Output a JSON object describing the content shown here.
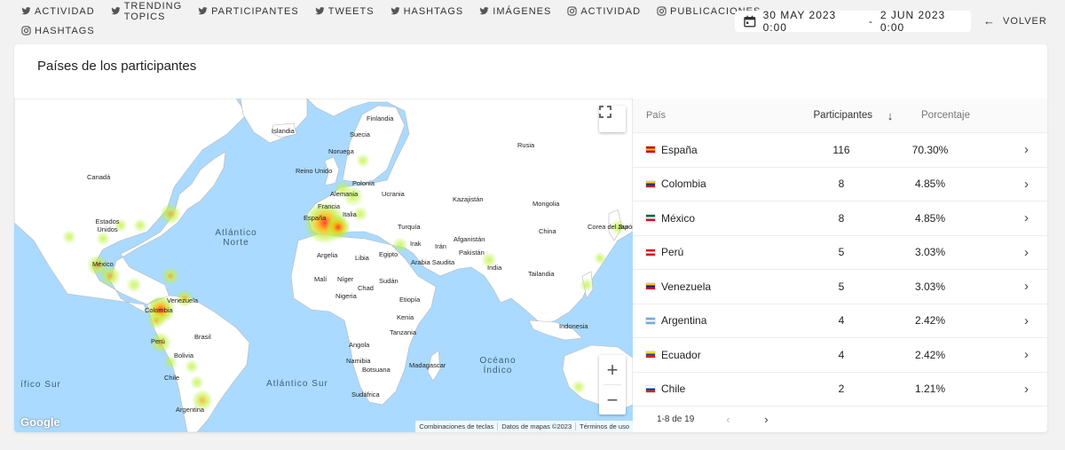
{
  "nav": {
    "row1": [
      {
        "label": "ACTIVIDAD",
        "icon": "twitter-icon"
      },
      {
        "label": "TRENDING TOPICS",
        "icon": "twitter-icon"
      },
      {
        "label": "PARTICIPANTES",
        "icon": "twitter-icon"
      },
      {
        "label": "TWEETS",
        "icon": "twitter-icon"
      },
      {
        "label": "HASHTAGS",
        "icon": "twitter-icon"
      },
      {
        "label": "IMÁGENES",
        "icon": "twitter-icon"
      },
      {
        "label": "ACTIVIDAD",
        "icon": "instagram-icon"
      },
      {
        "label": "PUBLICACIONES",
        "icon": "instagram-icon"
      }
    ],
    "row2": [
      {
        "label": "HASHTAGS",
        "icon": "instagram-icon"
      }
    ]
  },
  "daterange": {
    "start": "30 MAY 2023 0:00",
    "separator": "-",
    "end": "2 JUN 2023 0:00"
  },
  "back_label": "VOLVER",
  "card_title": "Países de los participantes",
  "map": {
    "labels": [
      "Islandia",
      "Finlandia",
      "Suecia",
      "Noruega",
      "Rusia",
      "Reino Unido",
      "Polonia",
      "Alemania",
      "Ucrania",
      "Canadá",
      "Francia",
      "Kazajistán",
      "Mongolia",
      "España",
      "Italia",
      "Estados Unidos",
      "Turquía",
      "Corea del Sur",
      "Japón",
      "China",
      "Irak",
      "Irán",
      "Afganistán",
      "Argelia",
      "Libia",
      "Egipto",
      "Arabia Saudita",
      "Pakistán",
      "India",
      "México",
      "Malí",
      "Níger",
      "Chad",
      "Sudán",
      "Tailandia",
      "Venezuela",
      "Colombia",
      "Nigeria",
      "Etiopía",
      "Kenia",
      "Perú",
      "Brasil",
      "Tanzania",
      "Indonesia",
      "Bolivia",
      "Angola",
      "Chile",
      "Namibia",
      "Botsuana",
      "Madagascar",
      "Sudáfrica",
      "Argentina"
    ],
    "oceans": [
      "Atlántico Norte",
      "Atlántico Sur",
      "Océano Índico",
      "ífico Sur"
    ],
    "google": "Google",
    "attribution": [
      "Combinaciones de teclas",
      "Datos de mapas ©2023",
      "Términos de uso"
    ]
  },
  "table": {
    "headers": {
      "country": "País",
      "participants": "Participantes",
      "percentage": "Porcentaje"
    },
    "rows": [
      {
        "country": "España",
        "participants": "116",
        "percentage": "70.30%",
        "flag": [
          "#c60b1e",
          "#ffc400",
          "#c60b1e"
        ]
      },
      {
        "country": "Colombia",
        "participants": "8",
        "percentage": "4.85%",
        "flag": [
          "#fcd116",
          "#003893",
          "#ce1126"
        ]
      },
      {
        "country": "México",
        "participants": "8",
        "percentage": "4.85%",
        "flag": [
          "#006847",
          "#ffffff",
          "#ce1126"
        ]
      },
      {
        "country": "Perú",
        "participants": "5",
        "percentage": "3.03%",
        "flag": [
          "#d91023",
          "#ffffff",
          "#d91023"
        ]
      },
      {
        "country": "Venezuela",
        "participants": "5",
        "percentage": "3.03%",
        "flag": [
          "#ffcc00",
          "#00247d",
          "#cf142b"
        ]
      },
      {
        "country": "Argentina",
        "participants": "4",
        "percentage": "2.42%",
        "flag": [
          "#74acdf",
          "#ffffff",
          "#74acdf"
        ]
      },
      {
        "country": "Ecuador",
        "participants": "4",
        "percentage": "2.42%",
        "flag": [
          "#ffdd00",
          "#034ea2",
          "#ed1c24"
        ]
      },
      {
        "country": "Chile",
        "participants": "2",
        "percentage": "1.21%",
        "flag": [
          "#ffffff",
          "#0039a6",
          "#d52b1e"
        ]
      }
    ],
    "pagination": "1-8 de 19"
  }
}
